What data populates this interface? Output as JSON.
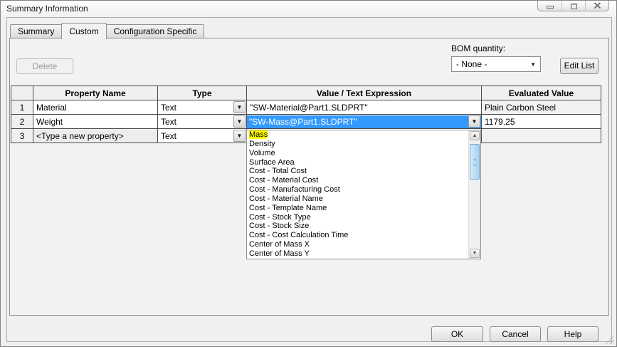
{
  "window": {
    "title": "Summary Information"
  },
  "icons": {
    "dropdown_arrow": "▼",
    "scroll_up_arrow": "▲",
    "scroll_down_arrow": "▼"
  },
  "tabs": [
    {
      "label": "Summary",
      "active": false
    },
    {
      "label": "Custom",
      "active": true
    },
    {
      "label": "Configuration Specific",
      "active": false
    }
  ],
  "toolbar": {
    "delete_label": "Delete",
    "bom_quantity_label": "BOM quantity:",
    "bom_quantity_value": "- None -",
    "edit_list_label": "Edit List"
  },
  "table": {
    "headers": [
      "",
      "Property Name",
      "Type",
      "Value / Text Expression",
      "Evaluated Value"
    ],
    "rows": [
      {
        "num": "1",
        "property_name": "Material",
        "type": "Text",
        "value": "\"SW-Material@Part1.SLDPRT\"",
        "evaluated": "Plain Carbon Steel"
      },
      {
        "num": "2",
        "property_name": "Weight",
        "type": "Text",
        "value": "\"SW-Mass@Part1.SLDPRT\"",
        "evaluated": "1179.25"
      },
      {
        "num": "3",
        "property_name": "<Type a new property>",
        "type": "Text",
        "value": "",
        "evaluated": ""
      }
    ]
  },
  "dropdown": {
    "items": [
      "Mass",
      "Density",
      "Volume",
      "Surface Area",
      "Cost - Total Cost",
      "Cost - Material Cost",
      "Cost - Manufacturing Cost",
      "Cost - Material Name",
      "Cost - Template Name",
      "Cost - Stock Type",
      "Cost - Stock Size",
      "Cost - Cost Calculation Time",
      "Center of Mass X",
      "Center of Mass Y"
    ]
  },
  "footer": {
    "ok_label": "OK",
    "cancel_label": "Cancel",
    "help_label": "Help"
  },
  "colors": {
    "selection_blue": "#3399ff",
    "highlight_yellow": "#ffff00",
    "selected_text": "#ffffff"
  }
}
